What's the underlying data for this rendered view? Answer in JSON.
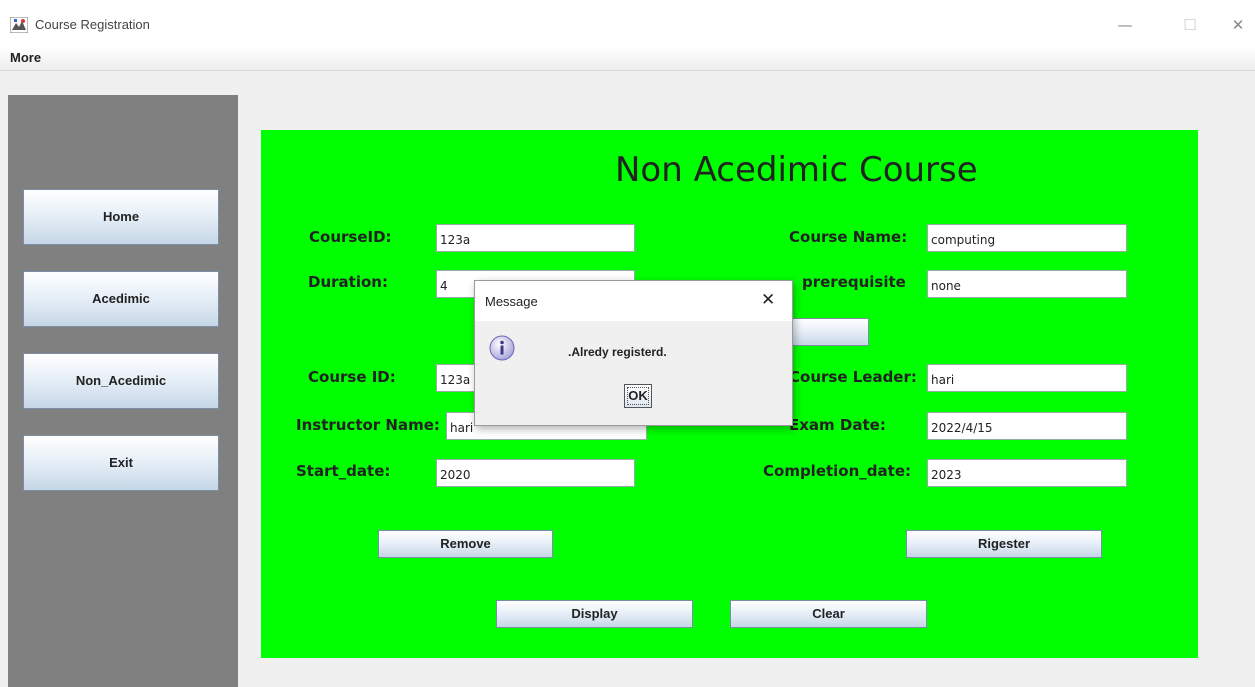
{
  "window": {
    "title": "Course Registration",
    "minimize_glyph": "—",
    "maximize_glyph": "☐",
    "close_glyph": "✕"
  },
  "menu": {
    "more": "More"
  },
  "sidebar": {
    "items": [
      {
        "label": "Home"
      },
      {
        "label": "Acedimic"
      },
      {
        "label": "Non_Acedimic"
      },
      {
        "label": "Exit"
      }
    ]
  },
  "form": {
    "heading": "Non Acedimic Course",
    "course_id_label": "CourseID:",
    "course_id_value": "123a",
    "course_name_label": "Course Name:",
    "course_name_value": "computing",
    "duration_label": "Duration:",
    "duration_value": "4",
    "prerequisite_label": "prerequisite",
    "prerequisite_value": "none",
    "course_id2_label": "Course ID:",
    "course_id2_value": "123a",
    "course_leader_label": "Course Leader:",
    "course_leader_value": "hari",
    "instructor_label": "Instructor Name:",
    "instructor_value": "hari",
    "exam_date_label": "Exam Date:",
    "exam_date_value": "2022/4/15",
    "start_date_label": "Start_date:",
    "start_date_value": "2020",
    "completion_date_label": "Completion_date:",
    "completion_date_value": "2023",
    "buttons": {
      "remove": "Remove",
      "register": "Rigester",
      "display": "Display",
      "clear": "Clear"
    }
  },
  "dialog": {
    "title": "Message",
    "close_glyph": "✕",
    "icon": "info-icon",
    "message": ".Alredy registerd.",
    "ok": "OK"
  },
  "colors": {
    "panel": "#00ff00",
    "sidebar": "#808080"
  }
}
